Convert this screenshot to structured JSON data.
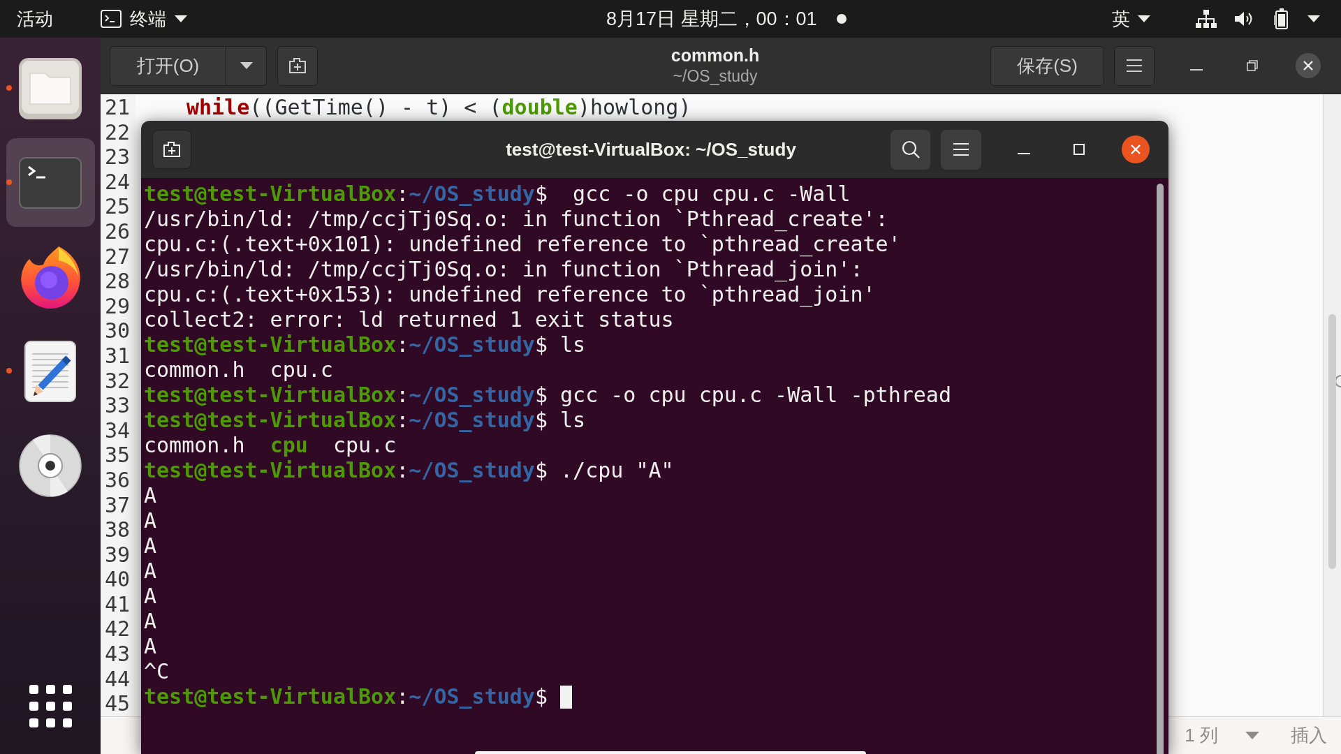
{
  "top_bar": {
    "activities": "活动",
    "app_menu": "终端",
    "clock": "8月17日 星期二，00：01",
    "notification": true,
    "input_method": "英"
  },
  "dock": {
    "items": [
      {
        "kind": "files",
        "running": true,
        "selected": false
      },
      {
        "kind": "terminal",
        "running": true,
        "selected": true
      },
      {
        "kind": "browser",
        "running": false,
        "selected": false
      },
      {
        "kind": "editor",
        "running": true,
        "selected": false
      },
      {
        "kind": "disc",
        "running": false,
        "selected": false
      }
    ]
  },
  "editor_window": {
    "open_button": "打开(O)",
    "title": "common.h",
    "subtitle": "~/OS_study",
    "save_button": "保存(S)",
    "line_numbers": [
      "21",
      "22",
      "23",
      "24",
      "25",
      "26",
      "27",
      "28",
      "29",
      "30",
      "31",
      "32",
      "33",
      "34",
      "35",
      "36",
      "37",
      "38",
      "39",
      "40",
      "41",
      "42",
      "43",
      "44",
      "45"
    ],
    "code_lines": [
      {
        "segments": [
          {
            "kind": "keyword",
            "text": "while"
          },
          {
            "kind": "plain",
            "text": "((GetTime() - t) < ("
          },
          {
            "kind": "type",
            "text": "double"
          },
          {
            "kind": "plain",
            "text": ")howlong)"
          }
        ]
      }
    ],
    "status_bar": {
      "position": "1 列",
      "mode": "插入"
    }
  },
  "terminal_window": {
    "title": "test@test-VirtualBox: ~/OS_study",
    "lines": [
      {
        "cursor": false,
        "segments": [
          {
            "kind": "user_host",
            "text": "test@test-VirtualBox"
          },
          {
            "kind": "plain",
            "text": ":"
          },
          {
            "kind": "path",
            "text": "~/OS_study"
          },
          {
            "kind": "plain",
            "text": "$  gcc -o cpu cpu.c -Wall"
          }
        ]
      },
      {
        "cursor": false,
        "segments": [
          {
            "kind": "plain",
            "text": "/usr/bin/ld: /tmp/ccjTj0Sq.o: in function `Pthread_create':"
          }
        ]
      },
      {
        "cursor": false,
        "segments": [
          {
            "kind": "plain",
            "text": "cpu.c:(.text+0x101): undefined reference to `pthread_create'"
          }
        ]
      },
      {
        "cursor": false,
        "segments": [
          {
            "kind": "plain",
            "text": "/usr/bin/ld: /tmp/ccjTj0Sq.o: in function `Pthread_join':"
          }
        ]
      },
      {
        "cursor": false,
        "segments": [
          {
            "kind": "plain",
            "text": "cpu.c:(.text+0x153): undefined reference to `pthread_join'"
          }
        ]
      },
      {
        "cursor": false,
        "segments": [
          {
            "kind": "plain",
            "text": "collect2: error: ld returned 1 exit status"
          }
        ]
      },
      {
        "cursor": false,
        "segments": [
          {
            "kind": "user_host",
            "text": "test@test-VirtualBox"
          },
          {
            "kind": "plain",
            "text": ":"
          },
          {
            "kind": "path",
            "text": "~/OS_study"
          },
          {
            "kind": "plain",
            "text": "$ ls"
          }
        ]
      },
      {
        "cursor": false,
        "segments": [
          {
            "kind": "plain",
            "text": "common.h  cpu.c"
          }
        ]
      },
      {
        "cursor": false,
        "segments": [
          {
            "kind": "user_host",
            "text": "test@test-VirtualBox"
          },
          {
            "kind": "plain",
            "text": ":"
          },
          {
            "kind": "path",
            "text": "~/OS_study"
          },
          {
            "kind": "plain",
            "text": "$ gcc -o cpu cpu.c -Wall -pthread"
          }
        ]
      },
      {
        "cursor": false,
        "segments": [
          {
            "kind": "user_host",
            "text": "test@test-VirtualBox"
          },
          {
            "kind": "plain",
            "text": ":"
          },
          {
            "kind": "path",
            "text": "~/OS_study"
          },
          {
            "kind": "plain",
            "text": "$ ls"
          }
        ]
      },
      {
        "cursor": false,
        "segments": [
          {
            "kind": "plain",
            "text": "common.h  "
          },
          {
            "kind": "executable",
            "text": "cpu"
          },
          {
            "kind": "plain",
            "text": "  cpu.c"
          }
        ]
      },
      {
        "cursor": false,
        "segments": [
          {
            "kind": "user_host",
            "text": "test@test-VirtualBox"
          },
          {
            "kind": "plain",
            "text": ":"
          },
          {
            "kind": "path",
            "text": "~/OS_study"
          },
          {
            "kind": "plain",
            "text": "$ ./cpu \"A\""
          }
        ]
      },
      {
        "cursor": false,
        "segments": [
          {
            "kind": "plain",
            "text": "A"
          }
        ]
      },
      {
        "cursor": false,
        "segments": [
          {
            "kind": "plain",
            "text": "A"
          }
        ]
      },
      {
        "cursor": false,
        "segments": [
          {
            "kind": "plain",
            "text": "A"
          }
        ]
      },
      {
        "cursor": false,
        "segments": [
          {
            "kind": "plain",
            "text": "A"
          }
        ]
      },
      {
        "cursor": false,
        "segments": [
          {
            "kind": "plain",
            "text": "A"
          }
        ]
      },
      {
        "cursor": false,
        "segments": [
          {
            "kind": "plain",
            "text": "A"
          }
        ]
      },
      {
        "cursor": false,
        "segments": [
          {
            "kind": "plain",
            "text": "A"
          }
        ]
      },
      {
        "cursor": false,
        "segments": [
          {
            "kind": "plain",
            "text": "^C"
          }
        ]
      },
      {
        "cursor": true,
        "segments": [
          {
            "kind": "user_host",
            "text": "test@test-VirtualBox"
          },
          {
            "kind": "plain",
            "text": ":"
          },
          {
            "kind": "path",
            "text": "~/OS_study"
          },
          {
            "kind": "plain",
            "text": "$"
          }
        ]
      }
    ]
  }
}
